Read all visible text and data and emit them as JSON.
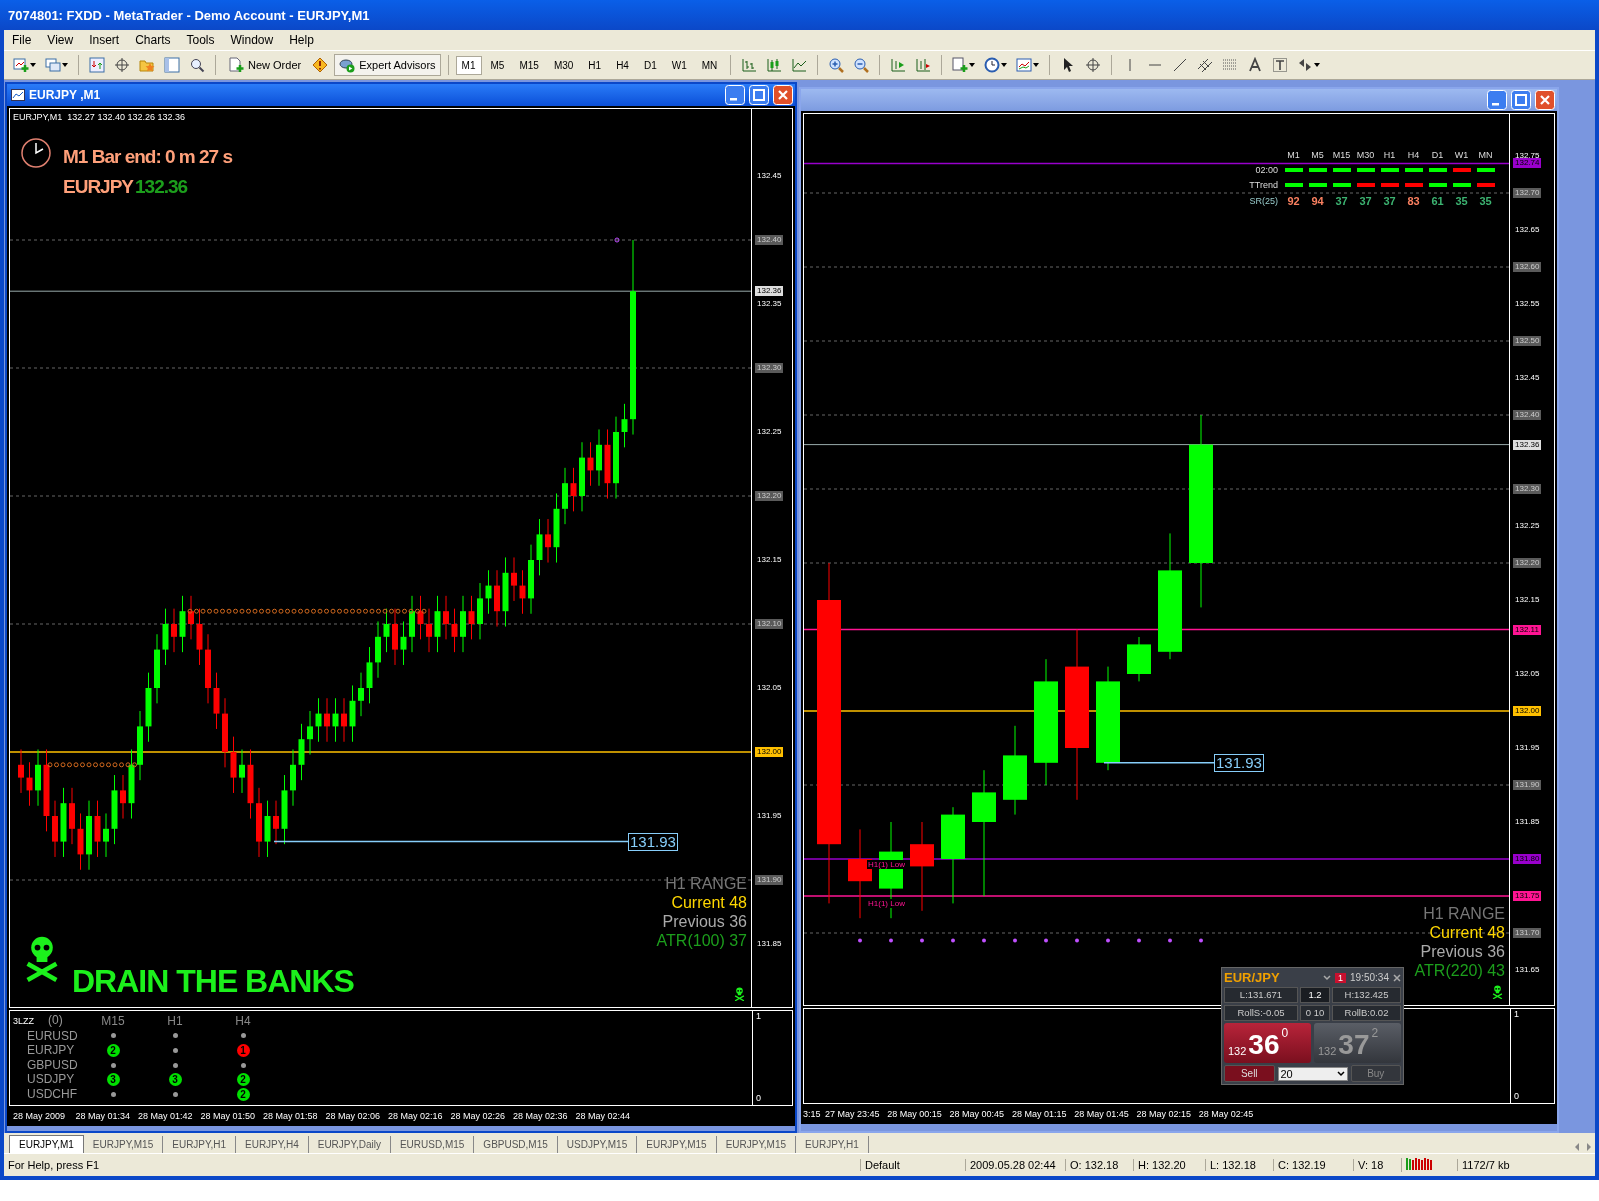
{
  "app_title": "7074801: FXDD - MetaTrader - Demo Account - EURJPY,M1",
  "menu": [
    "File",
    "View",
    "Insert",
    "Charts",
    "Tools",
    "Window",
    "Help"
  ],
  "toolbar": {
    "new_order": "New Order",
    "expert_advisors": "Expert Advisors",
    "timeframes": [
      {
        "label": "M1",
        "selected": true
      },
      {
        "label": "M5",
        "selected": false
      },
      {
        "label": "M15",
        "selected": false
      },
      {
        "label": "M30",
        "selected": false
      },
      {
        "label": "H1",
        "selected": false
      },
      {
        "label": "H4",
        "selected": false
      },
      {
        "label": "D1",
        "selected": false
      },
      {
        "label": "W1",
        "selected": false
      },
      {
        "label": "MN",
        "selected": false
      }
    ]
  },
  "charts": [
    {
      "title": "EURJPY ,M1",
      "active": true,
      "header": "EURJPY,M1  132.27 132.40 132.26 132.36",
      "bar_timer": "M1 Bar end: 0 m 27 s",
      "symbol": "EURJPY",
      "price": "132.36",
      "price_labels": [
        {
          "text": "132.45",
          "kind": "plain"
        },
        {
          "text": "132.40",
          "kind": "grid"
        },
        {
          "text": "132.36",
          "kind": "current"
        },
        {
          "text": "132.35",
          "kind": "plain"
        },
        {
          "text": "132.30",
          "kind": "grid"
        },
        {
          "text": "132.25",
          "kind": "plain"
        },
        {
          "text": "132.20",
          "kind": "grid"
        },
        {
          "text": "132.15",
          "kind": "plain"
        },
        {
          "text": "132.10",
          "kind": "grid"
        },
        {
          "text": "132.05",
          "kind": "plain"
        },
        {
          "text": "132.00",
          "kind": "level",
          "color": "#ffc000"
        },
        {
          "text": "131.95",
          "kind": "plain"
        },
        {
          "text": "131.90",
          "kind": "grid"
        },
        {
          "text": "131.85",
          "kind": "plain"
        }
      ],
      "line_label": "131.93",
      "range": {
        "title": "H1 RANGE",
        "current": "Current 48",
        "previous": "Previous 36",
        "atr": "ATR(100) 37"
      },
      "banner": "DRAIN THE BANKS",
      "indicator": {
        "name": "3LZZ",
        "count": "(0)",
        "columns": [
          "M15",
          "H1",
          "H4"
        ],
        "rows": [
          {
            "symbol": "EURUSD",
            "signals": [
              {
                "kind": "dot"
              },
              {
                "kind": "dot"
              },
              {
                "kind": "dot"
              }
            ]
          },
          {
            "symbol": "EURJPY",
            "signals": [
              {
                "kind": "badge",
                "text": "2",
                "color": "#00e000"
              },
              {
                "kind": "dot"
              },
              {
                "kind": "badge",
                "text": "1",
                "color": "#ff0000"
              }
            ]
          },
          {
            "symbol": "GBPUSD",
            "signals": [
              {
                "kind": "dot"
              },
              {
                "kind": "dot"
              },
              {
                "kind": "dot"
              }
            ]
          },
          {
            "symbol": "USDJPY",
            "signals": [
              {
                "kind": "badge",
                "text": "3",
                "color": "#00e000"
              },
              {
                "kind": "badge",
                "text": "3",
                "color": "#00e000"
              },
              {
                "kind": "badge",
                "text": "2",
                "color": "#00e000"
              }
            ]
          },
          {
            "symbol": "USDCHF",
            "signals": [
              {
                "kind": "dot"
              },
              {
                "kind": "dot"
              },
              {
                "kind": "badge",
                "text": "2",
                "color": "#00e000"
              }
            ]
          }
        ]
      },
      "sub_scale": [
        "1",
        "0"
      ],
      "time_labels": [
        "28 May 2009",
        "28 May 01:34",
        "28 May 01:42",
        "28 May 01:50",
        "28 May 01:58",
        "28 May 02:06",
        "28 May 02:16",
        "28 May 02:26",
        "28 May 02:36",
        "28 May 02:44"
      ]
    },
    {
      "active": false,
      "price_labels": [
        {
          "text": "132.75",
          "kind": "plain"
        },
        {
          "text": "132.74",
          "kind": "level",
          "color": "#9900cc"
        },
        {
          "text": "132.70",
          "kind": "grid"
        },
        {
          "text": "132.65",
          "kind": "plain"
        },
        {
          "text": "132.60",
          "kind": "grid"
        },
        {
          "text": "132.55",
          "kind": "plain"
        },
        {
          "text": "132.50",
          "kind": "grid"
        },
        {
          "text": "132.45",
          "kind": "plain"
        },
        {
          "text": "132.40",
          "kind": "grid"
        },
        {
          "text": "132.36",
          "kind": "current"
        },
        {
          "text": "132.30",
          "kind": "grid"
        },
        {
          "text": "132.25",
          "kind": "plain"
        },
        {
          "text": "132.20",
          "kind": "grid"
        },
        {
          "text": "132.15",
          "kind": "plain"
        },
        {
          "text": "132.11",
          "kind": "level",
          "color": "#ff1493"
        },
        {
          "text": "132.05",
          "kind": "plain"
        },
        {
          "text": "132.00",
          "kind": "level",
          "color": "#ffc000"
        },
        {
          "text": "131.95",
          "kind": "plain"
        },
        {
          "text": "131.90",
          "kind": "grid"
        },
        {
          "text": "131.85",
          "kind": "plain"
        },
        {
          "text": "131.80",
          "kind": "level",
          "color": "#9900cc"
        },
        {
          "text": "131.75",
          "kind": "level",
          "color": "#ff1493"
        },
        {
          "text": "131.70",
          "kind": "grid"
        },
        {
          "text": "131.65",
          "kind": "plain"
        }
      ],
      "trend_table": {
        "columns": [
          "M1",
          "M5",
          "M15",
          "M30",
          "H1",
          "H4",
          "D1",
          "W1",
          "MN"
        ],
        "rows": [
          {
            "label": "02:00",
            "kind": "bars",
            "cells": [
              {
                "color": "#00ff00"
              },
              {
                "color": "#00ff00"
              },
              {
                "color": "#00ff00"
              },
              {
                "color": "#00ff00"
              },
              {
                "color": "#00ff00"
              },
              {
                "color": "#00ff00"
              },
              {
                "color": "#00ff00"
              },
              {
                "color": "#ff0000"
              },
              {
                "color": "#00ff00"
              }
            ]
          },
          {
            "label": "TTrend",
            "kind": "bars",
            "cells": [
              {
                "color": "#00ff00"
              },
              {
                "color": "#00ff00"
              },
              {
                "color": "#00ff00"
              },
              {
                "color": "#ff0000"
              },
              {
                "color": "#ff0000"
              },
              {
                "color": "#ff0000"
              },
              {
                "color": "#00ff00"
              },
              {
                "color": "#00ff00"
              },
              {
                "color": "#ff0000"
              }
            ]
          },
          {
            "label": "SR(25)",
            "kind": "numbers",
            "cells": [
              {
                "text": "92",
                "color": "#fa8060"
              },
              {
                "text": "94",
                "color": "#fa8060"
              },
              {
                "text": "37",
                "color": "#3cb371"
              },
              {
                "text": "37",
                "color": "#3cb371"
              },
              {
                "text": "37",
                "color": "#3cb371"
              },
              {
                "text": "83",
                "color": "#fa8060"
              },
              {
                "text": "61",
                "color": "#3cb371"
              },
              {
                "text": "35",
                "color": "#3cb371"
              },
              {
                "text": "35",
                "color": "#3cb371"
              }
            ]
          }
        ]
      },
      "low_labels": [
        "H1(1) Low",
        "H1(1) Low"
      ],
      "line_label": "131.93",
      "range": {
        "title": "H1 RANGE",
        "current": "Current 48",
        "previous": "Previous 36",
        "atr": "ATR(220) 43"
      },
      "sub_scale": [
        "1",
        "0"
      ],
      "time_labels": [
        "3:15",
        "27 May 23:45",
        "28 May 00:15",
        "28 May 00:45",
        "28 May 01:15",
        "28 May 01:45",
        "28 May 02:15",
        "28 May 02:45"
      ],
      "trade_panel": {
        "symbol": "EUR/JPY",
        "badge": "1",
        "time": "19:50:34",
        "low": "L:131.671",
        "spread": "1.2",
        "high": "H:132.425",
        "roll_sell": "RollS:-0.05",
        "roll_mid": "0 10",
        "roll_buy": "RollB:0.02",
        "sell": {
          "big": "132",
          "pips": "36",
          "frac": "0",
          "label": "Sell"
        },
        "buy": {
          "big": "132",
          "pips": "37",
          "frac": "2",
          "label": "Buy"
        },
        "lots": "20"
      }
    }
  ],
  "tabs": [
    {
      "label": "EURJPY,M1",
      "selected": true
    },
    {
      "label": "EURJPY,M15",
      "selected": false
    },
    {
      "label": "EURJPY,H1",
      "selected": false
    },
    {
      "label": "EURJPY,H4",
      "selected": false
    },
    {
      "label": "EURJPY,Daily",
      "selected": false
    },
    {
      "label": "EURUSD,M15",
      "selected": false
    },
    {
      "label": "GBPUSD,M15",
      "selected": false
    },
    {
      "label": "USDJPY,M15",
      "selected": false
    },
    {
      "label": "EURJPY,M15",
      "selected": false
    },
    {
      "label": "EURJPY,M15",
      "selected": false
    },
    {
      "label": "EURJPY,H1",
      "selected": false
    }
  ],
  "status_bar": {
    "help": "For Help, press F1",
    "profile": "Default",
    "datetime": "2009.05.28 02:44",
    "open": "O: 132.18",
    "high": "H: 132.20",
    "low": "L: 132.18",
    "close": "C: 132.19",
    "volume": "V: 18",
    "traffic": "1172/7 kb"
  }
}
